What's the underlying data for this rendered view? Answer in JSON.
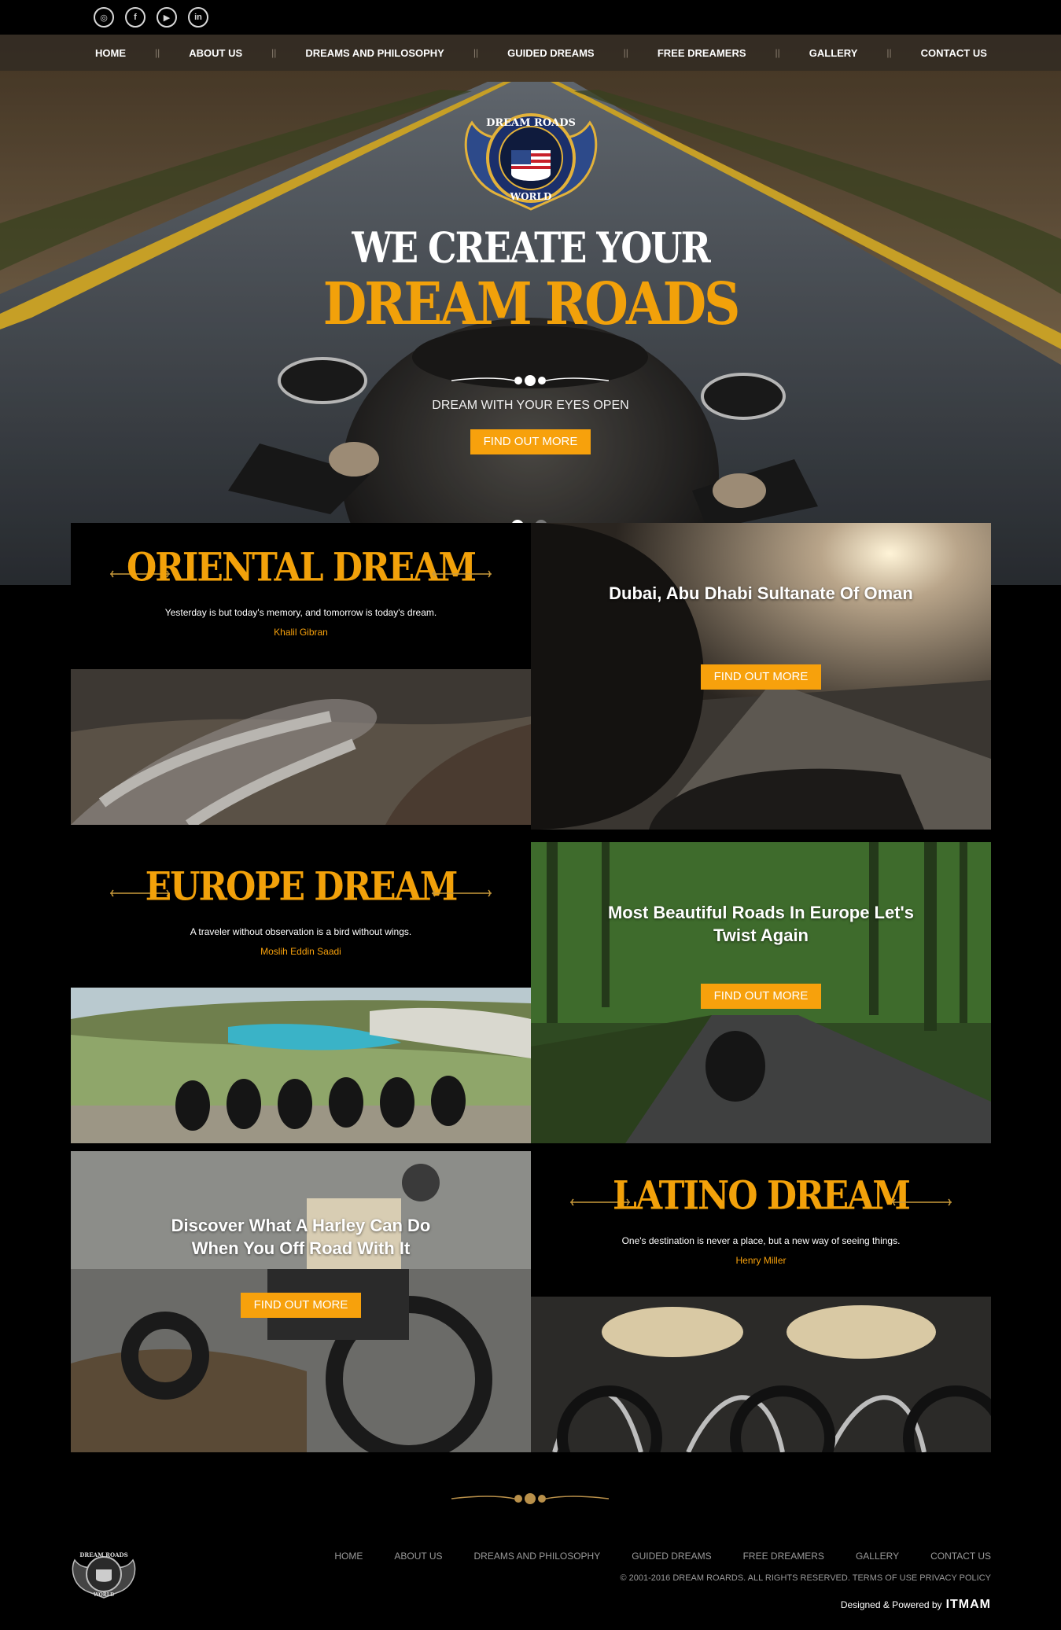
{
  "social": [
    {
      "name": "instagram-icon",
      "glyph": "◎"
    },
    {
      "name": "facebook-icon",
      "glyph": "f"
    },
    {
      "name": "youtube-icon",
      "glyph": "▶"
    },
    {
      "name": "linkedin-icon",
      "glyph": "in"
    }
  ],
  "nav": [
    "HOME",
    "ABOUT US",
    "DREAMS AND PHILOSOPHY",
    "GUIDED DREAMS",
    "FREE DREAMERS",
    "GALLERY",
    "CONTACT US"
  ],
  "hero": {
    "logo_top": "DREAM ROADS",
    "logo_bottom": "WORLD",
    "line1": "WE CREATE YOUR",
    "line2": "DREAM ROADS",
    "subtitle": "DREAM WITH YOUR EYES OPEN",
    "button": "FIND OUT MORE",
    "slides": 2,
    "active_slide": 1
  },
  "dreams": {
    "oriental": {
      "title": "ORIENTAL DREAM",
      "quote": "Yesterday is but today's memory, and tomorrow is today's dream.",
      "author": "Khalil Gibran"
    },
    "oriental_promo": {
      "title": "Dubai, Abu Dhabi Sultanate Of Oman",
      "button": "FIND OUT MORE"
    },
    "europe": {
      "title": "EUROPE DREAM",
      "quote": "A traveler without observation is a bird without wings.",
      "author": "Moslih Eddin Saadi"
    },
    "europe_promo": {
      "title": "Most Beautiful Roads In Europe Let's Twist Again",
      "button": "FIND OUT MORE"
    },
    "harley_promo": {
      "title": "Discover What A Harley Can Do When You Off Road With It",
      "button": "FIND OUT MORE"
    },
    "latino": {
      "title": "LATINO DREAM",
      "quote": "One's destination is never a place, but a new way of seeing things.",
      "author": "Henry Miller"
    }
  },
  "footer": {
    "nav": [
      "HOME",
      "ABOUT US",
      "DREAMS AND PHILOSOPHY",
      "GUIDED DREAMS",
      "FREE DREAMERS",
      "GALLERY",
      "CONTACT US"
    ],
    "copyright": "© 2001-2016 DREAM ROARDS. ALL RIGHTS RESERVED. TERMS OF USE PRIVACY POLICY",
    "powered_label": "Designed & Powered by",
    "powered_brand": "ITMAM"
  },
  "colors": {
    "accent": "#f7a10c",
    "background": "#000000",
    "nav_bg": "#342c24"
  }
}
